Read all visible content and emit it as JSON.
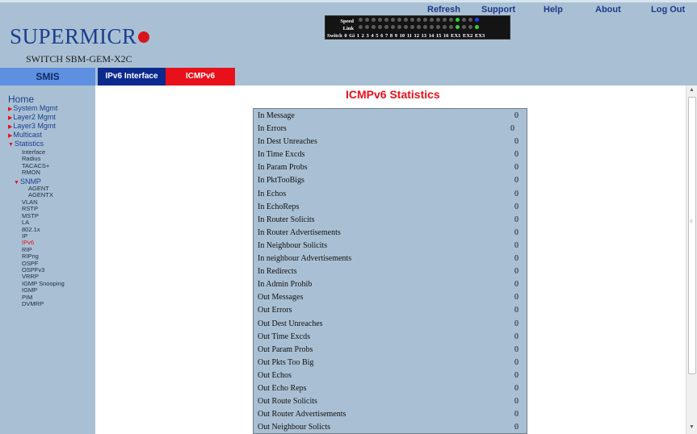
{
  "header": {
    "logo_text": "SUPERMICR",
    "switch_name": "SWITCH SBM-GEM-X2C",
    "links": [
      "Refresh",
      "Support",
      "Help",
      "About",
      "Log Out"
    ],
    "port_panel": {
      "speed_label": "Speed",
      "link_label": "Link",
      "numbers_label": "Switch 0 Gi  1  2  3  4  5  6  7  8  9  10  11  12  13  14  15  16  EX1  EX2  EX3",
      "led_colors": {
        "off": "#5c5c5c",
        "green": "#35d43d",
        "blue": "#2a3cff"
      }
    }
  },
  "tabs": {
    "smis": "SMIS",
    "ipv6": "IPv6 Interface",
    "icmpv6": "ICMPv6"
  },
  "sidebar": {
    "home": "Home",
    "system_mgmt": "System Mgmt",
    "layer2_mgmt": "Layer2 Mgmt",
    "layer3_mgmt": "Layer3 Mgmt",
    "multicast": "Multicast",
    "statistics": "Statistics",
    "stats_items_a": [
      "Interface",
      "Radius",
      "TACACS+",
      "RMON"
    ],
    "snmp": "SNMP",
    "snmp_items": [
      "AGENT",
      "AGENTX"
    ],
    "stats_items_b": [
      "VLAN",
      "RSTP",
      "MSTP",
      "LA",
      "802.1x",
      "IP",
      "IPv6",
      "RIP",
      "RIPng",
      "OSPF",
      "OSPFv3",
      "VRRP",
      "IGMP Snooping",
      "IGMP",
      "PIM",
      "DVMRP"
    ],
    "active_item": "IPv6"
  },
  "main": {
    "title": "ICMPv6 Statistics",
    "rows": [
      {
        "name": "In Message",
        "value": "0"
      },
      {
        "name": "In Errors",
        "value": "0"
      },
      {
        "name": "In Dest Unreaches",
        "value": "0"
      },
      {
        "name": "In Time Excds",
        "value": "0"
      },
      {
        "name": "In Param Probs",
        "value": "0"
      },
      {
        "name": "In PktTooBigs",
        "value": "0"
      },
      {
        "name": "In Echos",
        "value": "0"
      },
      {
        "name": "In EchoReps",
        "value": "0"
      },
      {
        "name": "In Router Solicits",
        "value": "0"
      },
      {
        "name": "In Router Advertisements",
        "value": "0"
      },
      {
        "name": "In Neighbour Solicits",
        "value": "0"
      },
      {
        "name": "In neighbour Advertisements",
        "value": "0"
      },
      {
        "name": "In Redirects",
        "value": "0"
      },
      {
        "name": "In Admin Prohib",
        "value": "0"
      },
      {
        "name": "Out Messages",
        "value": "0"
      },
      {
        "name": "Out Errors",
        "value": "0"
      },
      {
        "name": "Out Dest Unreaches",
        "value": "0"
      },
      {
        "name": "Out Time Excds",
        "value": "0"
      },
      {
        "name": "Out Param Probs",
        "value": "0"
      },
      {
        "name": "Out Pkts Too Big",
        "value": "0"
      },
      {
        "name": "Out Echos",
        "value": "0"
      },
      {
        "name": "Out Echo Reps",
        "value": "0"
      },
      {
        "name": "Out Route Solicits",
        "value": "0"
      },
      {
        "name": "Out Router Advertisements",
        "value": "0"
      },
      {
        "name": "Out Neighbour Solicts",
        "value": "0"
      }
    ]
  },
  "colors": {
    "accent_red": "#e8101a",
    "nav_blue": "#1b3e8f",
    "panel_bg": "#a9c0d4"
  }
}
